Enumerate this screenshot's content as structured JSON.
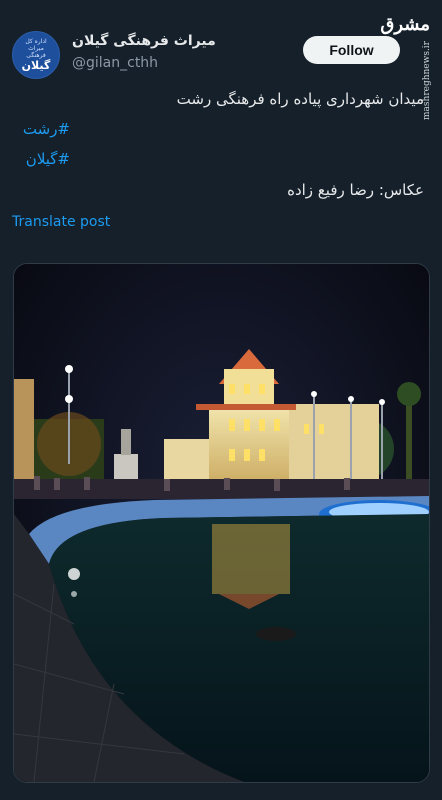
{
  "account": {
    "name": "میراث فرهنگی گیلان",
    "handle": "@gilan_cthh",
    "avatar_word": "گیلان",
    "avatar_ring": "اداره کل میراث فرهنگی"
  },
  "follow_label": "Follow",
  "watermark": {
    "brand": "مشرق",
    "site": "mashreghnews.ir"
  },
  "post": {
    "text": "میدان شهرداری پیاده راه فرهنگی رشت",
    "hashtags": [
      "#رشت",
      "#گیلان"
    ],
    "credit": "عکاس: رضا رفیع زاده"
  },
  "translate_label": "Translate post",
  "photo": {
    "description_icon": "night-square-photo"
  },
  "colors": {
    "background": "#15202b",
    "link": "#1d9bf0",
    "follow_bg": "#eff3f4"
  }
}
